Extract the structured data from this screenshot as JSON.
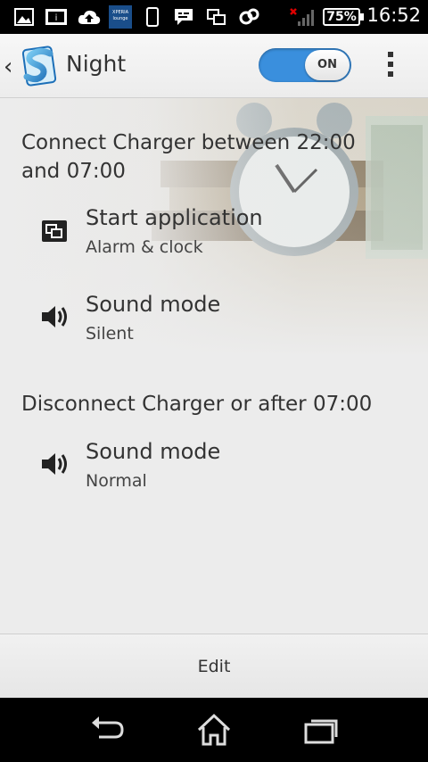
{
  "status_bar": {
    "icons": [
      "picture-icon",
      "info-notification-icon",
      "cloud-upload-icon",
      "xperia-lounge-icon",
      "phone-icon",
      "message-icon",
      "screen-mirror-icon",
      "sync-icon",
      "no-signal-icon"
    ],
    "xperia_text": "XPERIA lounge",
    "battery": "75%",
    "time": "16:52"
  },
  "action_bar": {
    "title": "Night",
    "toggle_label": "ON",
    "toggle_state": "on",
    "accent": "#3a8fdd"
  },
  "sections": [
    {
      "header": "Connect Charger between 22:00 and 07:00",
      "items": [
        {
          "icon": "start-application-icon",
          "title": "Start application",
          "subtitle": "Alarm & clock"
        },
        {
          "icon": "speaker-icon",
          "title": "Sound mode",
          "subtitle": "Silent"
        }
      ]
    },
    {
      "header": "Disconnect Charger or after 07:00",
      "items": [
        {
          "icon": "speaker-icon",
          "title": "Sound mode",
          "subtitle": "Normal"
        }
      ]
    }
  ],
  "bottom_bar": {
    "edit_label": "Edit"
  },
  "nav_bar": {
    "buttons": [
      "back-icon",
      "home-icon",
      "recent-apps-icon"
    ]
  }
}
